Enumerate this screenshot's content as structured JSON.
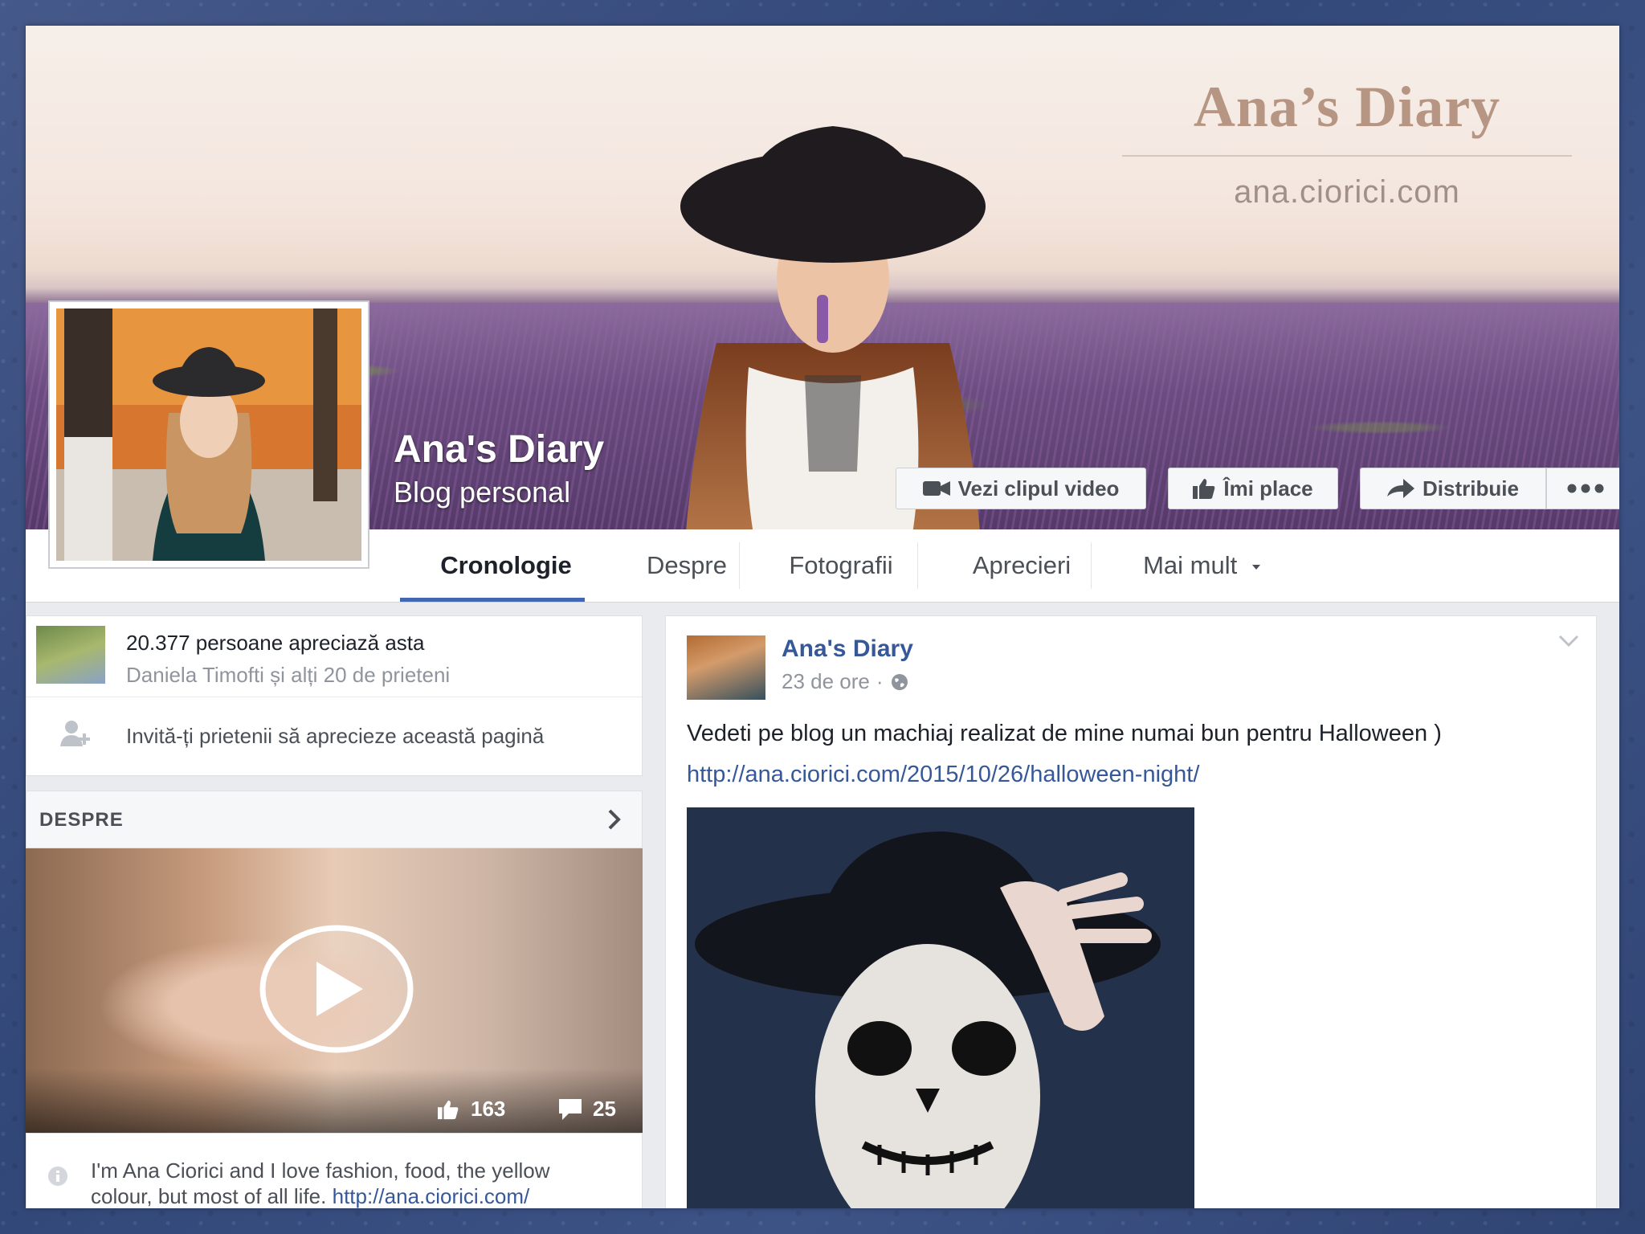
{
  "cover": {
    "brand_title": "Ana’s Diary",
    "brand_url": "ana.ciorici.com"
  },
  "page": {
    "name": "Ana's Diary",
    "category": "Blog personal"
  },
  "actions": {
    "watch_video": "Vezi clipul video",
    "like": "Îmi place",
    "share": "Distribuie"
  },
  "nav": {
    "tabs": [
      "Cronologie",
      "Despre",
      "Fotografii",
      "Aprecieri",
      "Mai mult"
    ],
    "active": "Cronologie"
  },
  "sidebar": {
    "likes_count": "20.377 persoane apreciază asta",
    "likes_friends": "Daniela Timofti și alți 20 de prieteni",
    "invite": "Invită-ți prietenii să aprecieze această pagină",
    "about_label": "DESPRE",
    "video_likes": "163",
    "video_comments": "25",
    "about_line1": "I'm Ana Ciorici and I love fashion, food, the yellow",
    "about_line2": "colour, but most of all life.",
    "about_link": "http://ana.ciorici.com/"
  },
  "post": {
    "author": "Ana's Diary",
    "time": "23 de ore",
    "separator": "·",
    "text": "Vedeti pe blog un machiaj realizat de mine numai bun pentru Halloween )",
    "link": "http://ana.ciorici.com/2015/10/26/halloween-night/"
  },
  "colors": {
    "accent": "#4267b2",
    "link": "#365899",
    "page_bg": "#e9ebee"
  },
  "icons": [
    "video-camera-icon",
    "thumbs-up-icon",
    "share-arrow-icon",
    "more-dots-icon",
    "add-friend-icon",
    "chevron-right-icon",
    "play-icon",
    "comment-icon",
    "globe-icon",
    "caret-down-icon",
    "info-icon"
  ]
}
